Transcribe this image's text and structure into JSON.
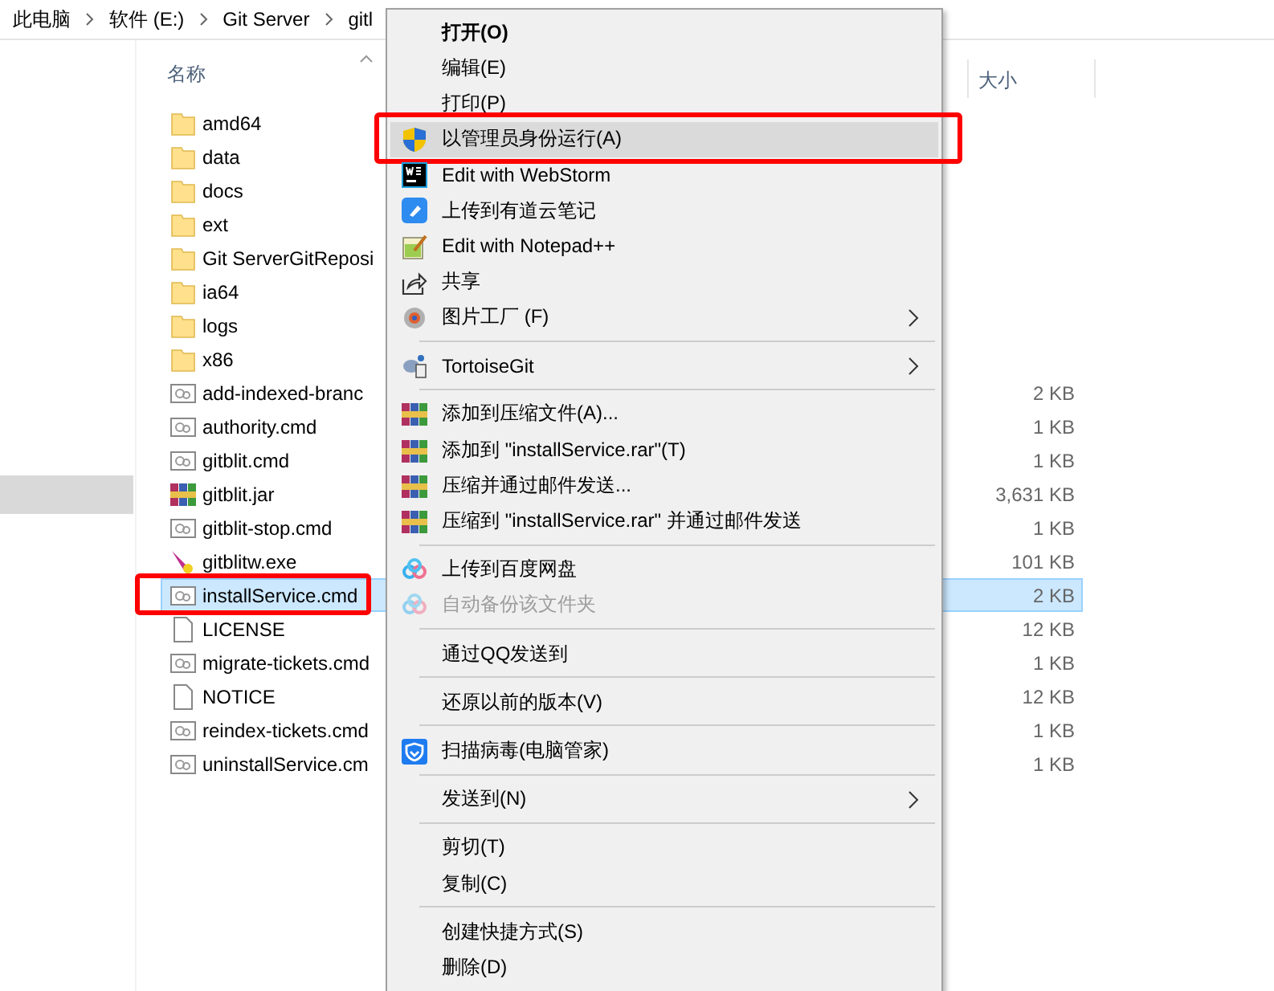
{
  "breadcrumb": [
    "此电脑",
    "软件 (E:)",
    "Git Server",
    "gitl"
  ],
  "file_list": {
    "columns": [
      "名称",
      "大小"
    ],
    "rows": [
      {
        "name": "amd64",
        "kind": "folder",
        "size": "",
        "selected": false,
        "marked": false
      },
      {
        "name": "data",
        "kind": "folder",
        "size": "",
        "selected": false,
        "marked": false
      },
      {
        "name": "docs",
        "kind": "folder",
        "size": "",
        "selected": false,
        "marked": false
      },
      {
        "name": "ext",
        "kind": "folder",
        "size": "",
        "selected": false,
        "marked": false
      },
      {
        "name": "Git ServerGitReposi",
        "kind": "folder",
        "size": "",
        "selected": false,
        "marked": false
      },
      {
        "name": "ia64",
        "kind": "folder",
        "size": "",
        "selected": false,
        "marked": false
      },
      {
        "name": "logs",
        "kind": "folder",
        "size": "",
        "selected": false,
        "marked": false
      },
      {
        "name": "x86",
        "kind": "folder",
        "size": "",
        "selected": false,
        "marked": false
      },
      {
        "name": "add-indexed-branc",
        "kind": "script",
        "size": "2 KB",
        "selected": false,
        "marked": false
      },
      {
        "name": "authority.cmd",
        "kind": "script",
        "size": "1 KB",
        "selected": false,
        "marked": false
      },
      {
        "name": "gitblit.cmd",
        "kind": "script",
        "size": "1 KB",
        "selected": false,
        "marked": false
      },
      {
        "name": "gitblit.jar",
        "kind": "archive",
        "size": "3,631 KB",
        "selected": false,
        "marked": false
      },
      {
        "name": "gitblit-stop.cmd",
        "kind": "script",
        "size": "1 KB",
        "selected": false,
        "marked": false
      },
      {
        "name": "gitblitw.exe",
        "kind": "program",
        "size": "101 KB",
        "selected": false,
        "marked": false
      },
      {
        "name": "installService.cmd",
        "kind": "script",
        "size": "2 KB",
        "selected": true,
        "marked": true
      },
      {
        "name": "LICENSE",
        "kind": "document",
        "size": "12 KB",
        "selected": false,
        "marked": false
      },
      {
        "name": "migrate-tickets.cmd",
        "kind": "script",
        "size": "1 KB",
        "selected": false,
        "marked": false
      },
      {
        "name": "NOTICE",
        "kind": "document",
        "size": "12 KB",
        "selected": false,
        "marked": false
      },
      {
        "name": "reindex-tickets.cmd",
        "kind": "script",
        "size": "1 KB",
        "selected": false,
        "marked": false
      },
      {
        "name": "uninstallService.cm",
        "kind": "script",
        "size": "1 KB",
        "selected": false,
        "marked": false
      }
    ]
  },
  "context_menu": {
    "items": [
      {
        "kind": "item",
        "label": "打开(O)",
        "default": true,
        "selected": false,
        "disabled": false,
        "submenu": false,
        "marked": false
      },
      {
        "kind": "item",
        "label": "编辑(E)",
        "default": false,
        "selected": false,
        "disabled": false,
        "submenu": false,
        "marked": false
      },
      {
        "kind": "item",
        "label": "打印(P)",
        "default": false,
        "selected": false,
        "disabled": false,
        "submenu": false,
        "marked": false
      },
      {
        "kind": "item",
        "label": "以管理员身份运行(A)",
        "default": false,
        "selected": true,
        "disabled": false,
        "submenu": false,
        "marked": true
      },
      {
        "kind": "item",
        "label": "Edit with WebStorm",
        "default": false,
        "selected": false,
        "disabled": false,
        "submenu": false,
        "marked": false
      },
      {
        "kind": "item",
        "label": "上传到有道云笔记",
        "default": false,
        "selected": false,
        "disabled": false,
        "submenu": false,
        "marked": false
      },
      {
        "kind": "item",
        "label": "Edit with Notepad++",
        "default": false,
        "selected": false,
        "disabled": false,
        "submenu": false,
        "marked": false
      },
      {
        "kind": "item",
        "label": "共享",
        "default": false,
        "selected": false,
        "disabled": false,
        "submenu": false,
        "marked": false
      },
      {
        "kind": "item",
        "label": "图片工厂 (F)",
        "default": false,
        "selected": false,
        "disabled": false,
        "submenu": true,
        "marked": false
      },
      {
        "kind": "separator"
      },
      {
        "kind": "item",
        "label": "TortoiseGit",
        "default": false,
        "selected": false,
        "disabled": false,
        "submenu": true,
        "marked": false
      },
      {
        "kind": "separator"
      },
      {
        "kind": "item",
        "label": "添加到压缩文件(A)...",
        "default": false,
        "selected": false,
        "disabled": false,
        "submenu": false,
        "marked": false
      },
      {
        "kind": "item",
        "label": "添加到 \"installService.rar\"(T)",
        "default": false,
        "selected": false,
        "disabled": false,
        "submenu": false,
        "marked": false
      },
      {
        "kind": "item",
        "label": "压缩并通过邮件发送...",
        "default": false,
        "selected": false,
        "disabled": false,
        "submenu": false,
        "marked": false
      },
      {
        "kind": "item",
        "label": "压缩到 \"installService.rar\" 并通过邮件发送",
        "default": false,
        "selected": false,
        "disabled": false,
        "submenu": false,
        "marked": false
      },
      {
        "kind": "separator"
      },
      {
        "kind": "item",
        "label": "上传到百度网盘",
        "default": false,
        "selected": false,
        "disabled": false,
        "submenu": false,
        "marked": false
      },
      {
        "kind": "item",
        "label": "自动备份该文件夹",
        "default": false,
        "selected": false,
        "disabled": true,
        "submenu": false,
        "marked": false
      },
      {
        "kind": "separator"
      },
      {
        "kind": "item",
        "label": "通过QQ发送到",
        "default": false,
        "selected": false,
        "disabled": false,
        "submenu": false,
        "marked": false
      },
      {
        "kind": "separator"
      },
      {
        "kind": "item",
        "label": "还原以前的版本(V)",
        "default": false,
        "selected": false,
        "disabled": false,
        "submenu": false,
        "marked": false
      },
      {
        "kind": "separator"
      },
      {
        "kind": "item",
        "label": "扫描病毒(电脑管家)",
        "default": false,
        "selected": false,
        "disabled": false,
        "submenu": false,
        "marked": false
      },
      {
        "kind": "separator"
      },
      {
        "kind": "item",
        "label": "发送到(N)",
        "default": false,
        "selected": false,
        "disabled": false,
        "submenu": true,
        "marked": false
      },
      {
        "kind": "separator"
      },
      {
        "kind": "item",
        "label": "剪切(T)",
        "default": false,
        "selected": false,
        "disabled": false,
        "submenu": false,
        "marked": false
      },
      {
        "kind": "item",
        "label": "复制(C)",
        "default": false,
        "selected": false,
        "disabled": false,
        "submenu": false,
        "marked": false
      },
      {
        "kind": "separator"
      },
      {
        "kind": "item",
        "label": "创建快捷方式(S)",
        "default": false,
        "selected": false,
        "disabled": false,
        "submenu": false,
        "marked": false
      },
      {
        "kind": "item",
        "label": "删除(D)",
        "default": false,
        "selected": false,
        "disabled": false,
        "submenu": false,
        "marked": false
      }
    ]
  }
}
